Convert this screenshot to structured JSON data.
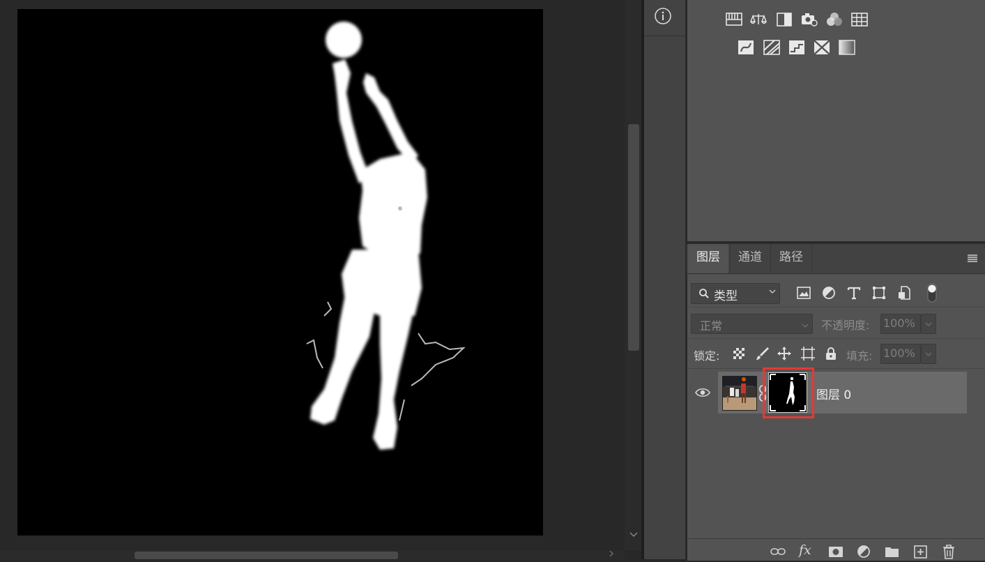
{
  "canvas": {
    "description_icon": "document-mask-view"
  },
  "side_strip": {
    "info_icon": "info-icon"
  },
  "adjustments": {
    "row1": [
      "levels-icon",
      "curves-icon",
      "exposure-icon",
      "camera-raw-icon",
      "color-balance-icon",
      "grid-icon"
    ],
    "row2": [
      "hue-icon",
      "gradient-map-icon",
      "posterize-icon",
      "threshold-icon",
      "gradient-fill-icon"
    ]
  },
  "layers_panel": {
    "tabs": [
      {
        "label": "图层"
      },
      {
        "label": "通道"
      },
      {
        "label": "路径"
      }
    ],
    "filter": {
      "label": "类型",
      "icons": [
        "image-filter-icon",
        "adjustment-filter-icon",
        "type-filter-icon",
        "shape-filter-icon",
        "smart-object-filter-icon",
        "filter-toggle-icon"
      ]
    },
    "blend_mode": "正常",
    "opacity_label": "不透明度:",
    "opacity_value": "100%",
    "lock_label": "锁定:",
    "fill_label": "填充:",
    "fill_value": "100%",
    "layers": [
      {
        "name": "图层 0",
        "visible": true,
        "has_mask": true
      }
    ],
    "highlight_color": "#e53935",
    "footer_icons": [
      "link-layers-icon",
      "fx-icon",
      "add-mask-icon",
      "adjustment-layer-icon",
      "group-folder-icon",
      "new-layer-icon",
      "trash-icon"
    ],
    "fx_label": "fx"
  }
}
